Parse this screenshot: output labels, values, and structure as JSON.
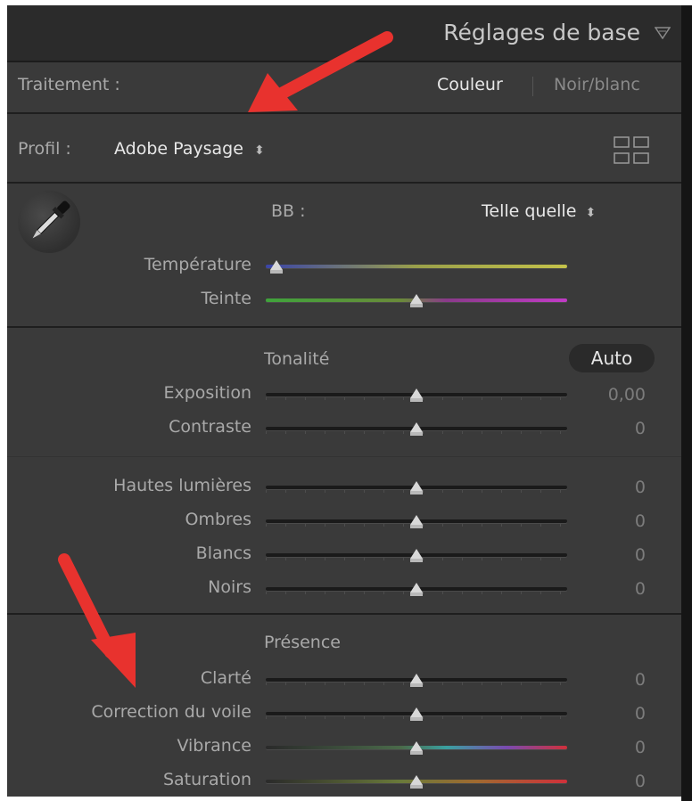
{
  "header": {
    "title": "Réglages de base"
  },
  "treatment": {
    "label": "Traitement :",
    "color": "Couleur",
    "bw": "Noir/blanc"
  },
  "profile": {
    "label": "Profil :",
    "value": "Adobe Paysage",
    "arrows": "⬍"
  },
  "wb": {
    "label": "BB :",
    "value": "Telle quelle",
    "arrows": "⬍"
  },
  "sliders_wb": [
    {
      "label": "Température",
      "level": 0.0
    },
    {
      "label": "Teinte",
      "level": 0.5
    }
  ],
  "tone": {
    "title": "Tonalité",
    "auto": "Auto",
    "sliders": [
      {
        "label": "Exposition",
        "value": "0,00",
        "level": 0.5
      },
      {
        "label": "Contraste",
        "value": "0",
        "level": 0.5
      }
    ],
    "sliders2": [
      {
        "label": "Hautes lumières",
        "value": "0",
        "level": 0.5
      },
      {
        "label": "Ombres",
        "value": "0",
        "level": 0.5
      },
      {
        "label": "Blancs",
        "value": "0",
        "level": 0.5
      },
      {
        "label": "Noirs",
        "value": "0",
        "level": 0.5
      }
    ]
  },
  "presence": {
    "title": "Présence",
    "sliders": [
      {
        "label": "Clarté",
        "value": "0",
        "level": 0.5
      },
      {
        "label": "Correction du voile",
        "value": "0",
        "level": 0.5
      },
      {
        "label": "Vibrance",
        "value": "0",
        "level": 0.5
      },
      {
        "label": "Saturation",
        "value": "0",
        "level": 0.5
      }
    ]
  },
  "colors": {
    "annotation_arrow": "#e8322e",
    "panel_bg": "#3a3a3a"
  }
}
